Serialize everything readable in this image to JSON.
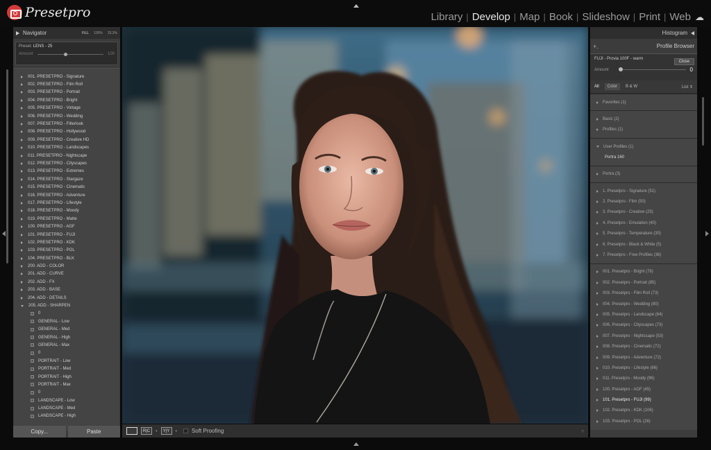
{
  "app": {
    "logo_text": "Presetpro"
  },
  "modules": {
    "items": [
      "Library",
      "Develop",
      "Map",
      "Book",
      "Slideshow",
      "Print",
      "Web"
    ],
    "active": "Develop"
  },
  "navigator": {
    "title": "Navigator",
    "zoom": [
      "FILL",
      "100%",
      "33.3%"
    ],
    "preset_label": "Preset:",
    "preset_value": "LENS - 25",
    "amount_label": "Amount",
    "amount_value": "100"
  },
  "presets": [
    "001. PRESETPRO - Signature",
    "002. PRESETPRO - Film Roll",
    "003. PRESETPRO - Portrait",
    "004. PRESETPRO - Bright",
    "005. PRESETPRO - Vintage",
    "006. PRESETPRO - Wedding",
    "007. PRESETPRO - Filterlook",
    "008. PRESETPRO - Hollywood",
    "009. PRESETPRO - Creative HD",
    "010. PRESETPRO - Landscapes",
    "011. PRESETPRO - Nightscape",
    "012. PRESETPRO - Cityscapes",
    "013. PRESETPRO - Extremes",
    "014. PRESETPRO - Stargaze",
    "015. PRESETPRO - Cinematic",
    "016. PRESETPRO - Adventure",
    "017. PRESETPRO - Lifestyle",
    "018. PRESETPRO - Moody",
    "019. PRESETPRO - Matte",
    "100. PRESETPRO - AGF",
    "101. PRESETPRO - FUJI",
    "102. PRESETPRO - KDK",
    "103. PRESETPRO - POL",
    "104. PRESETPRO - BLK",
    "200. ADD - COLOR",
    "201. ADD - CURVE",
    "202. ADD - FX",
    "203. ADD - BASE",
    "204. ADD - DETAILS"
  ],
  "expanded_preset": "205. ADD - SHARPEN",
  "expanded_items": [
    "0",
    "GENERAL - Low",
    "GENERAL - Med",
    "GENERAL - High",
    "GENERAL - Max",
    "0",
    "PORTRAIT - Low",
    "PORTRAIT - Med",
    "PORTRAIT - High",
    "PORTRAIT - Max",
    "0",
    "LANDSCAPE - Low",
    "LANDSCAPE - Med",
    "LANDSCAPE - High"
  ],
  "left_buttons": {
    "copy": "Copy...",
    "paste": "Paste"
  },
  "toolbar": {
    "view1": "",
    "view2": "R|C",
    "view3": "Y|Y",
    "soft_proofing": "Soft Proofing"
  },
  "histogram": {
    "title": "Histogram"
  },
  "profile_browser": {
    "plus": "+.",
    "title": "Profile Browser",
    "current": "FUJI - Provia 100F - warm",
    "close": "Close",
    "amount_label": "Amount",
    "amount_value": "0",
    "filters": [
      "All",
      "Color",
      "B & W"
    ],
    "list_label": "List",
    "groups": [
      {
        "items": [
          "Favorites (1)"
        ]
      },
      {
        "items": [
          "Basic (2)",
          "Profiles (1)"
        ]
      },
      {
        "expanded": "User Profiles (1)",
        "sub": [
          "Portra 160"
        ]
      },
      {
        "items": [
          "Portra (3)"
        ]
      },
      {
        "items": [
          "1. Presetpro - Signature (51)",
          "2. Presetpro - Film (50)",
          "3. Presetpro - Creative (25)",
          "4. Presetpro - Emulation (40)",
          "5. Presetpro - Temperature (30)",
          "6. Presetpro - Black & White (5)",
          "7. Presetpro - Free Profiles (36)"
        ]
      },
      {
        "items": [
          "001. Presetpro - Bright (78)",
          "002. Presetpro - Portrait (85)",
          "003. Presetpro - Film Roll (73)",
          "004. Presetpro - Wedding (80)",
          "005. Presetpro - Landscape (64)",
          "006. Presetpro - Cityscapes (73)",
          "007. Presetpro - Nightscape (53)",
          "008. Presetpro - Cinematic (72)",
          "009. Presetpro - Adventure (72)",
          "010. Presetpro - Lifestyle (66)",
          "011. Presetpro - Moody (96)",
          "100. Presetpro - AGF (45)",
          "101. Presetpro - FUJI (99)",
          "102. Presetpro - KDK (106)",
          "103. Presetpro - POL (26)"
        ],
        "highlight": "101. Presetpro - FUJI (99)"
      }
    ]
  },
  "colors": {
    "accent": "#d23b3b",
    "panel": "#3c3c3c",
    "background": "#0b0b0b"
  }
}
